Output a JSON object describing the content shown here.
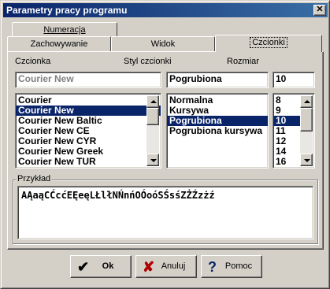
{
  "window": {
    "title": "Parametry pracy programu",
    "close_glyph": "✕"
  },
  "tabs": {
    "row1": [
      {
        "label": "Numeracja"
      }
    ],
    "row2": [
      {
        "label": "Zachowywanie"
      },
      {
        "label": "Widok"
      },
      {
        "label": "Czcionki"
      }
    ],
    "active": "Czcionki"
  },
  "font_panel": {
    "font_label": "Czcionka",
    "style_label": "Styl czcionki",
    "size_label": "Rozmiar",
    "font_value": "Courier New",
    "style_value": "Pogrubiona",
    "size_value": "10",
    "fonts": [
      "Courier",
      "Courier New",
      "Courier New Baltic",
      "Courier New CE",
      "Courier New CYR",
      "Courier New Greek",
      "Courier New TUR"
    ],
    "fonts_selected": "Courier New",
    "styles": [
      "Normalna",
      "Kursywa",
      "Pogrubiona",
      "Pogrubiona kursywa"
    ],
    "styles_selected": "Pogrubiona",
    "sizes": [
      "8",
      "9",
      "10",
      "11",
      "12",
      "14",
      "16"
    ],
    "sizes_selected": "10"
  },
  "preview": {
    "title": "Przykład",
    "sample": "AĄaąCĆcćEĘeęLŁlłNŃnńOÓoóSŚsśZŻŹzżź"
  },
  "buttons": {
    "ok": "Ok",
    "cancel": "Anuluj",
    "help": "Pomoc"
  },
  "colors": {
    "titlebar": "#0a246a",
    "selection": "#0a246a",
    "face": "#d4d0c8",
    "ok_check": "#000000",
    "cancel_x": "#b00000",
    "help_q": "#0a246a"
  }
}
